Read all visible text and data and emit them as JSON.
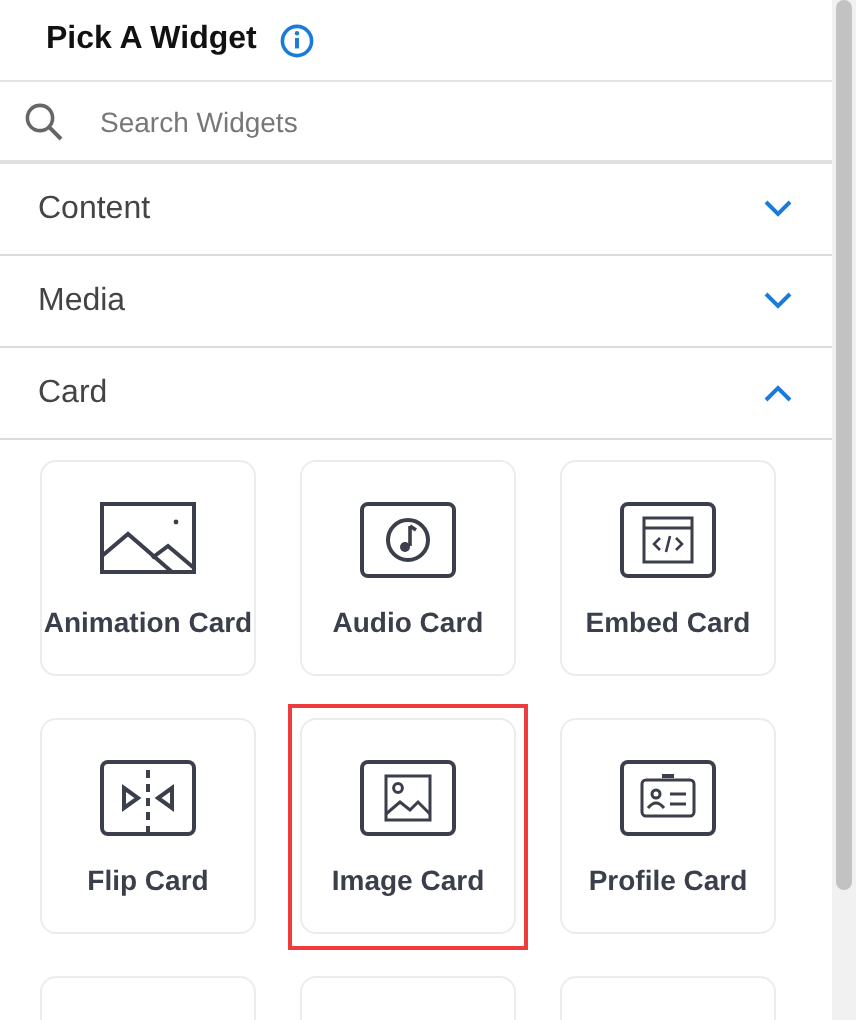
{
  "header": {
    "title": "Pick A Widget"
  },
  "search": {
    "placeholder": "Search Widgets"
  },
  "sections": [
    {
      "label": "Content",
      "expanded": false
    },
    {
      "label": "Media",
      "expanded": false
    },
    {
      "label": "Card",
      "expanded": true
    }
  ],
  "widgets": [
    {
      "kind": "animation",
      "label": "Animation Card",
      "highlighted": false
    },
    {
      "kind": "audio",
      "label": "Audio Card",
      "highlighted": false
    },
    {
      "kind": "embed",
      "label": "Embed Card",
      "highlighted": false
    },
    {
      "kind": "flip",
      "label": "Flip Card",
      "highlighted": false
    },
    {
      "kind": "image",
      "label": "Image Card",
      "highlighted": true
    },
    {
      "kind": "profile",
      "label": "Profile Card",
      "highlighted": false
    },
    {
      "kind": "clipped"
    },
    {
      "kind": "clipped"
    },
    {
      "kind": "clipped"
    }
  ]
}
